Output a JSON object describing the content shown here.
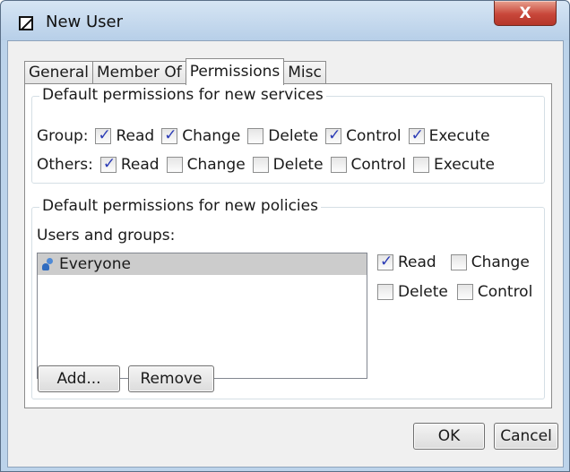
{
  "window": {
    "title": "New User",
    "close_glyph": "X"
  },
  "tabs": [
    {
      "label": "General",
      "active": false
    },
    {
      "label": "Member Of",
      "active": false
    },
    {
      "label": "Permissions",
      "active": true
    },
    {
      "label": "Misc",
      "active": false
    }
  ],
  "services": {
    "title": "Default permissions for new services",
    "group": {
      "label": "Group:",
      "options": [
        {
          "label": "Read",
          "checked": true
        },
        {
          "label": "Change",
          "checked": true
        },
        {
          "label": "Delete",
          "checked": false
        },
        {
          "label": "Control",
          "checked": true
        },
        {
          "label": "Execute",
          "checked": true
        }
      ]
    },
    "others": {
      "label": "Others:",
      "options": [
        {
          "label": "Read",
          "checked": true
        },
        {
          "label": "Change",
          "checked": false
        },
        {
          "label": "Delete",
          "checked": false
        },
        {
          "label": "Control",
          "checked": false
        },
        {
          "label": "Execute",
          "checked": false
        }
      ]
    }
  },
  "policies": {
    "title": "Default permissions for new policies",
    "users_label": "Users and groups:",
    "users": [
      {
        "name": "Everyone",
        "icon": "user-group-icon",
        "selected": true
      }
    ],
    "perms": [
      {
        "label": "Read",
        "checked": true
      },
      {
        "label": "Change",
        "checked": false
      },
      {
        "label": "Delete",
        "checked": false
      },
      {
        "label": "Control",
        "checked": false
      }
    ],
    "add_label": "Add...",
    "remove_label": "Remove"
  },
  "footer": {
    "ok_label": "OK",
    "cancel_label": "Cancel"
  }
}
